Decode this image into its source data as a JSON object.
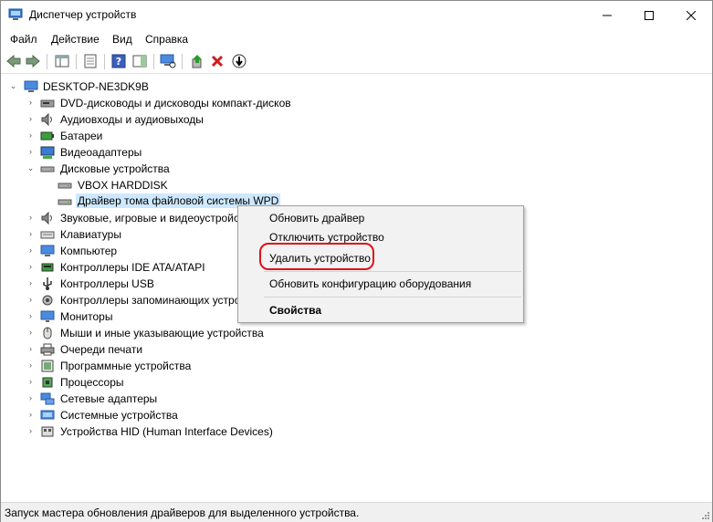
{
  "window": {
    "title": "Диспетчер устройств"
  },
  "menu": [
    "Файл",
    "Действие",
    "Вид",
    "Справка"
  ],
  "tree": {
    "root": "DESKTOP-NE3DK9B",
    "items": [
      {
        "label": "DVD-дисководы и дисководы компакт-дисков",
        "icon": "dvd-icon"
      },
      {
        "label": "Аудиовходы и аудиовыходы",
        "icon": "speaker-icon"
      },
      {
        "label": "Батареи",
        "icon": "battery-icon"
      },
      {
        "label": "Видеоадаптеры",
        "icon": "display-adapter-icon"
      },
      {
        "label": "Дисковые устройства",
        "icon": "disk-drive-icon",
        "expanded": true,
        "children": [
          {
            "label": "VBOX HARDDISK",
            "icon": "disk-drive-icon"
          },
          {
            "label": "Драйвер тома файловой системы WPD",
            "icon": "disk-drive-icon",
            "selected": true
          }
        ]
      },
      {
        "label": "Звуковые, игровые и видеоустройства",
        "icon": "speaker-icon"
      },
      {
        "label": "Клавиатуры",
        "icon": "keyboard-icon"
      },
      {
        "label": "Компьютер",
        "icon": "computer-icon"
      },
      {
        "label": "Контроллеры IDE ATA/ATAPI",
        "icon": "ide-controller-icon"
      },
      {
        "label": "Контроллеры USB",
        "icon": "usb-icon"
      },
      {
        "label": "Контроллеры запоминающих устройств",
        "icon": "storage-controller-icon"
      },
      {
        "label": "Мониторы",
        "icon": "monitor-icon"
      },
      {
        "label": "Мыши и иные указывающие устройства",
        "icon": "mouse-icon"
      },
      {
        "label": "Очереди печати",
        "icon": "printer-icon"
      },
      {
        "label": "Программные устройства",
        "icon": "software-device-icon"
      },
      {
        "label": "Процессоры",
        "icon": "processor-icon"
      },
      {
        "label": "Сетевые адаптеры",
        "icon": "network-adapter-icon"
      },
      {
        "label": "Системные устройства",
        "icon": "system-device-icon"
      },
      {
        "label": "Устройства HID (Human Interface Devices)",
        "icon": "hid-icon"
      }
    ]
  },
  "context_menu": {
    "update_driver": "Обновить драйвер",
    "disable_device": "Отключить устройство",
    "uninstall_device": "Удалить устройство",
    "scan_hardware": "Обновить конфигурацию оборудования",
    "properties": "Свойства"
  },
  "status": "Запуск мастера обновления драйверов для выделенного устройства.",
  "colors": {
    "selection": "#cde8ff",
    "highlight_ring": "#e0111a"
  }
}
